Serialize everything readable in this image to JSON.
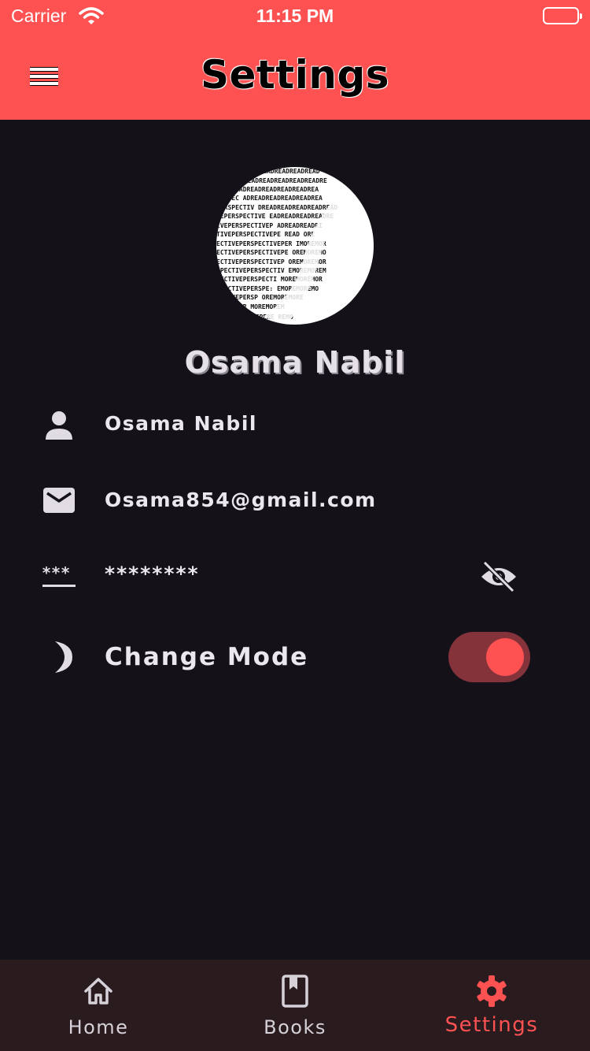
{
  "status_bar": {
    "carrier": "Carrier",
    "time": "11:15 PM"
  },
  "app_bar": {
    "title": "Settings"
  },
  "profile": {
    "name": "Osama Nabil"
  },
  "fields": {
    "username": "Osama Nabil",
    "email": "Osama854@gmail.com",
    "password_masked": "********"
  },
  "mode": {
    "label": "Change Mode",
    "dark_mode_enabled": true
  },
  "bottom_nav": {
    "items": [
      {
        "label": "Home",
        "icon": "home-icon",
        "active": false
      },
      {
        "label": "Books",
        "icon": "book-icon",
        "active": false
      },
      {
        "label": "Settings",
        "icon": "gear-icon",
        "active": true
      }
    ]
  },
  "colors": {
    "accent": "#fe5252",
    "background": "#141119",
    "nav_background": "#2a1b1f",
    "toggle_track": "#84333b",
    "text": "#ece7ee"
  }
}
